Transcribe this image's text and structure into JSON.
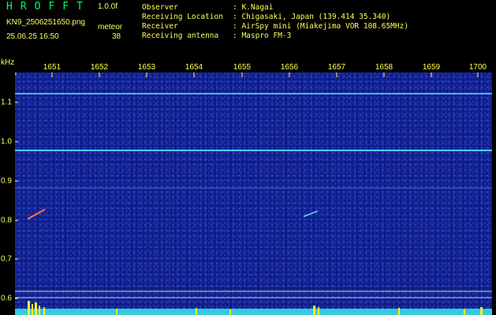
{
  "header": {
    "title": "HROFFT",
    "version": "1.0.0f",
    "filename": "KN9_2506251650.png",
    "meteor_label": "meteor",
    "datetime": "25.06.25 16:50",
    "meteor_count": "38"
  },
  "info": [
    {
      "label": "Observer",
      "value": ": K.Nagai"
    },
    {
      "label": "Receiving Location",
      "value": ": Chigasaki, Japan (139.414 35.340)"
    },
    {
      "label": "Receiver",
      "value": ": AirSpy mini (Miakejima VOR 108.65MHz)"
    },
    {
      "label": "Receiving antenna",
      "value": ": Maspro FM-3"
    }
  ],
  "axes": {
    "y_unit": "kHz",
    "y_ticks": [
      "1.1",
      "1.0",
      "0.9",
      "0.8",
      "0.7",
      "0.6"
    ],
    "x_ticks": [
      "1651",
      "1652",
      "1653",
      "1654",
      "1655",
      "1656",
      "1657",
      "1658",
      "1659",
      "1700"
    ]
  },
  "colors": {
    "label": "#ffff55",
    "title": "#00ff66",
    "background": "#0e1c84",
    "carrier": "#44ddff"
  }
}
